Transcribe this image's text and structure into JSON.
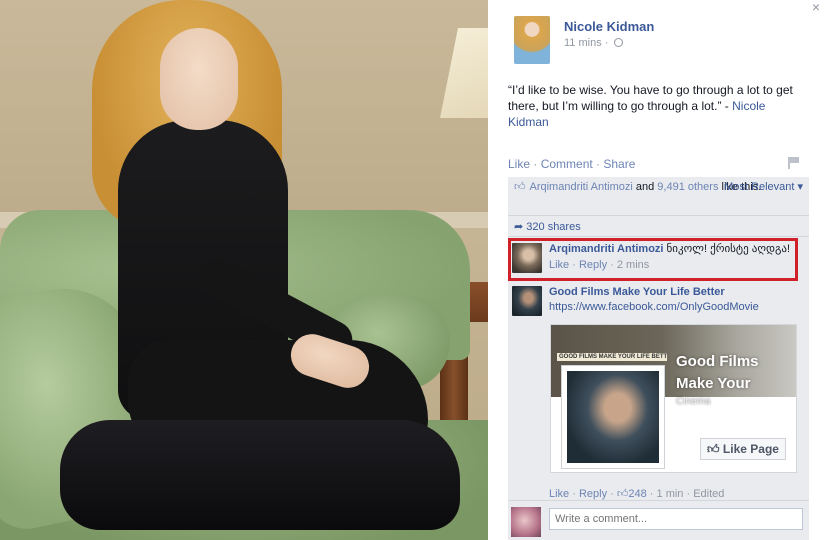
{
  "window": {
    "close_label": "×"
  },
  "post": {
    "author": "Nicole Kidman",
    "time": "11 mins",
    "time_separator": " · ",
    "quote": "“I’d like to be wise. You have to go through a lot to get there, but I’m willing to go through a lot.” - ",
    "quote_name": "Nicole Kidman",
    "actions": {
      "like": "Like",
      "comment": "Comment",
      "share": "Share"
    }
  },
  "ufi": {
    "likes_name": "Arqimandriti Antimozi",
    "likes_and": " and ",
    "likes_others": "9,491 others",
    "likes_suffix": " like this.",
    "sort_label": "Most Relevant",
    "shares": "320 shares"
  },
  "comments": [
    {
      "name": "Arqimandriti Antimozi",
      "text": " ნიკოლ! ქრისტე აღდგა!",
      "like": "Like",
      "reply": "Reply",
      "time": "2 mins"
    },
    {
      "name": "Good Films Make Your Life Better",
      "link": "https://www.facebook.com/OnlyGoodMovie",
      "like": "Like",
      "reply": "Reply",
      "likes_count": "248",
      "time": "1 min",
      "edited": "Edited"
    }
  ],
  "link_card": {
    "banner_text": "GOOD FILMS MAKE YOUR LIFE BETTER",
    "title_line1": "Good Films",
    "title_line2": "Make Your",
    "category": "Cinema",
    "like_page": "Like Page"
  },
  "composer": {
    "placeholder": "Write a comment..."
  },
  "colors": {
    "link": "#3b5998",
    "highlight": "#d0202a",
    "ufi_bg": "#e9ebee"
  }
}
